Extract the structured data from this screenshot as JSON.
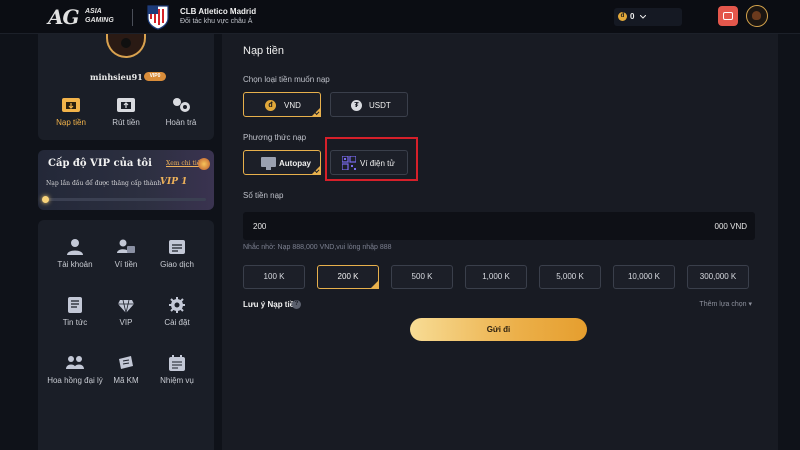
{
  "header": {
    "logo": {
      "mark": "AG",
      "line1": "ASIA",
      "line2": "GAMING"
    },
    "club": {
      "name": "CLB Atletico Madrid",
      "subtitle": "Đối tác khu vực châu Á"
    },
    "balance": {
      "coin_symbol": "đ",
      "value": "0"
    }
  },
  "profile": {
    "username": "minhsieu91",
    "vip_badge": "VIP0",
    "actions": [
      {
        "label": "Nạp tiền",
        "icon": "deposit-icon",
        "active": true
      },
      {
        "label": "Rút tiền",
        "icon": "withdraw-icon",
        "active": false
      },
      {
        "label": "Hoàn trả",
        "icon": "rebate-icon",
        "active": false
      }
    ]
  },
  "vip": {
    "title": "Cấp độ VIP của tôi",
    "link": "Xem chi tiết",
    "description": "Nạp lần đầu để được thăng cấp thành",
    "next_level": "VIP 1",
    "progress": 0
  },
  "menu": [
    {
      "label": "Tài khoản",
      "icon": "account-icon"
    },
    {
      "label": "Ví tiền",
      "icon": "wallet-icon"
    },
    {
      "label": "Giao dịch",
      "icon": "transactions-icon"
    },
    {
      "label": "Tin tức",
      "icon": "news-icon"
    },
    {
      "label": "VIP",
      "icon": "vip-diamond-icon"
    },
    {
      "label": "Cài đặt",
      "icon": "settings-gear-icon"
    },
    {
      "label": "Hoa hồng đại lý",
      "icon": "agent-commission-icon"
    },
    {
      "label": "Mã KM",
      "icon": "promo-code-icon"
    },
    {
      "label": "Nhiệm vụ",
      "icon": "missions-icon"
    }
  ],
  "deposit": {
    "title": "Nạp tiền",
    "currency_label": "Chọn loại tiền muốn nạp",
    "currencies": [
      {
        "label": "VND",
        "icon": "vnd-coin-icon",
        "selected": true
      },
      {
        "label": "USDT",
        "icon": "usdt-coin-icon",
        "selected": false
      }
    ],
    "method_label": "Phương thức nạp",
    "methods": [
      {
        "label": "Autopay",
        "icon": "autopay-monitor-icon",
        "selected": true
      },
      {
        "label": "Ví điện tử",
        "icon": "qr-code-icon",
        "selected": false
      }
    ],
    "amount_label": "Số tiền nạp",
    "amount_value": "200",
    "amount_unit": "000 VND",
    "hint": "Nhắc nhở: Nạp 888,000 VND,vui lòng nhập 888",
    "quick_amounts": [
      {
        "label": "100 K",
        "selected": false
      },
      {
        "label": "200 K",
        "selected": true
      },
      {
        "label": "500 K",
        "selected": false
      },
      {
        "label": "1,000 K",
        "selected": false
      },
      {
        "label": "5,000 K",
        "selected": false
      },
      {
        "label": "10,000 K",
        "selected": false
      },
      {
        "label": "300,000 K",
        "selected": false
      }
    ],
    "note_label": "Lưu ý Nạp tiền",
    "more_options": "Thêm lựa chọn",
    "submit": "Gửi đi"
  },
  "colors": {
    "accent": "#e7b04c",
    "background": "#0f1219",
    "panel": "#181b23",
    "highlight": "#d6202a"
  }
}
